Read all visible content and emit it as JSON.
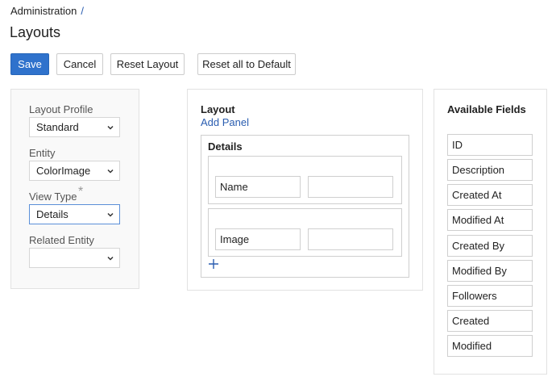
{
  "breadcrumb": {
    "root": "Administration",
    "separator": "/"
  },
  "page": {
    "title": "Layouts"
  },
  "toolbar": {
    "save": "Save",
    "cancel": "Cancel",
    "reset_layout": "Reset Layout",
    "reset_all": "Reset all to Default"
  },
  "settings": {
    "layout_profile": {
      "label": "Layout Profile",
      "value": "Standard"
    },
    "entity": {
      "label": "Entity",
      "value": "ColorImage"
    },
    "view_type": {
      "label": "View Type",
      "value": "Details",
      "required_mark": "*"
    },
    "related_entity": {
      "label": "Related Entity",
      "value": ""
    }
  },
  "layout": {
    "title": "Layout",
    "add_panel": "Add Panel",
    "panel": {
      "title": "Details",
      "rows": [
        {
          "cells": [
            "Name",
            ""
          ]
        },
        {
          "cells": [
            "Image",
            ""
          ]
        }
      ]
    }
  },
  "available_fields": {
    "title": "Available Fields",
    "items": [
      "ID",
      "Description",
      "Created At",
      "Modified At",
      "Created By",
      "Modified By",
      "Followers",
      "Created",
      "Modified"
    ]
  },
  "colors": {
    "primary": "#2f72cc",
    "link": "#2a5db0",
    "panel_bg": "#f9f9f9",
    "border": "#cfcfcf"
  },
  "icons": {
    "select_arrow": "chevron-down-icon",
    "add_row": "plus-icon"
  }
}
